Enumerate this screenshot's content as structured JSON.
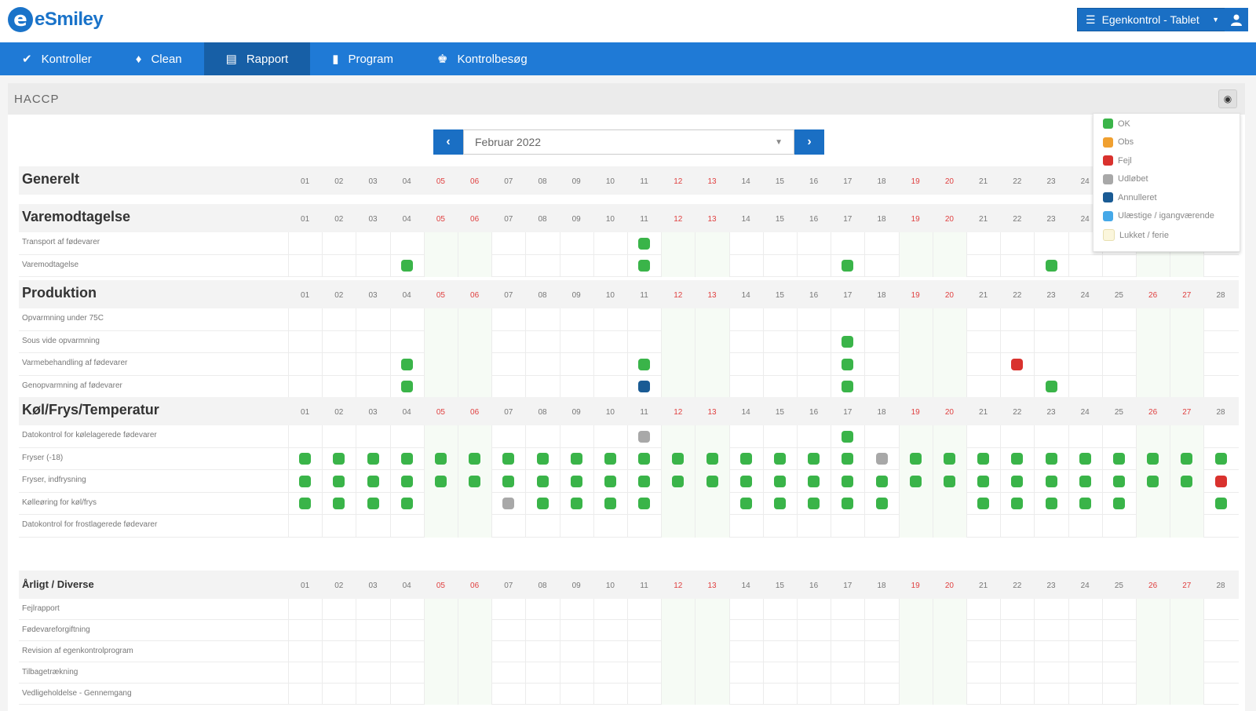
{
  "app": {
    "logo_mark": "e",
    "logo_text": "eSmiley"
  },
  "header": {
    "profile_label": "Egenkontrol - Tablet"
  },
  "nav": [
    {
      "label": "Kontroller",
      "icon": "check-icon",
      "glyph": "✔"
    },
    {
      "label": "Clean",
      "icon": "drop-icon",
      "glyph": "♦"
    },
    {
      "label": "Rapport",
      "icon": "report-icon",
      "glyph": "▤",
      "active": true
    },
    {
      "label": "Program",
      "icon": "program-icon",
      "glyph": "▮"
    },
    {
      "label": "Kontrolbesøg",
      "icon": "visit-icon",
      "glyph": "♚"
    }
  ],
  "panel": {
    "title": "HACCP"
  },
  "month": {
    "label": "Februar 2022",
    "prev_glyph": "‹",
    "next_glyph": "›"
  },
  "colors": {
    "ok": "#3ab449",
    "obs": "#f0a030",
    "fejl": "#d9322e",
    "udfoert": "#a8a8a8",
    "annulleret": "#1a5b94",
    "ulaest": "#45a8e8",
    "lukket": "#fbf6dc"
  },
  "legend": [
    {
      "label": "OK",
      "status": "ok"
    },
    {
      "label": "Obs",
      "status": "obs"
    },
    {
      "label": "Fejl",
      "status": "fejl"
    },
    {
      "label": "Udløbet",
      "status": "udfoert"
    },
    {
      "label": "Annulleret",
      "status": "annulleret"
    },
    {
      "label": "Ulæstige / igangværende",
      "status": "ulaest"
    },
    {
      "label": "Lukket / ferie",
      "status": "lukket"
    }
  ],
  "days": [
    "01",
    "02",
    "03",
    "04",
    "05",
    "06",
    "07",
    "08",
    "09",
    "10",
    "11",
    "12",
    "13",
    "14",
    "15",
    "16",
    "17",
    "18",
    "19",
    "20",
    "21",
    "22",
    "23",
    "24",
    "25",
    "26",
    "27",
    "28"
  ],
  "weekend_days": [
    5,
    6,
    12,
    13,
    19,
    20,
    26,
    27
  ],
  "sections": [
    {
      "title": "Generelt",
      "rows": []
    },
    {
      "title": "Varemodtagelse",
      "rows": [
        {
          "label": "Transport af fødevarer",
          "marks": [
            {
              "day": 11,
              "status": "ok"
            }
          ]
        },
        {
          "label": "Varemodtagelse",
          "marks": [
            {
              "day": 4,
              "status": "ok"
            },
            {
              "day": 11,
              "status": "ok"
            },
            {
              "day": 17,
              "status": "ok"
            },
            {
              "day": 23,
              "status": "ok"
            }
          ]
        }
      ]
    },
    {
      "title": "Produktion",
      "rows": [
        {
          "label": "Opvarmning under 75C",
          "marks": []
        },
        {
          "label": "Sous vide opvarmning",
          "marks": [
            {
              "day": 17,
              "status": "ok"
            }
          ]
        },
        {
          "label": "Varmebehandling af fødevarer",
          "marks": [
            {
              "day": 4,
              "status": "ok"
            },
            {
              "day": 11,
              "status": "ok"
            },
            {
              "day": 17,
              "status": "ok"
            },
            {
              "day": 22,
              "status": "fejl"
            }
          ]
        },
        {
          "label": "Genopvarmning af fødevarer",
          "marks": [
            {
              "day": 4,
              "status": "ok"
            },
            {
              "day": 11,
              "status": "annulleret"
            },
            {
              "day": 17,
              "status": "ok"
            },
            {
              "day": 23,
              "status": "ok"
            }
          ]
        }
      ]
    },
    {
      "title": "Køl/Frys/Temperatur",
      "rows": [
        {
          "label": "Datokontrol for kølelagerede fødevarer",
          "marks": [
            {
              "day": 11,
              "status": "udfoert"
            },
            {
              "day": 17,
              "status": "ok"
            }
          ]
        },
        {
          "label": "Fryser (-18)",
          "marks": [
            {
              "day": 1,
              "status": "ok"
            },
            {
              "day": 2,
              "status": "ok"
            },
            {
              "day": 3,
              "status": "ok"
            },
            {
              "day": 4,
              "status": "ok"
            },
            {
              "day": 5,
              "status": "ok"
            },
            {
              "day": 6,
              "status": "ok"
            },
            {
              "day": 7,
              "status": "ok"
            },
            {
              "day": 8,
              "status": "ok"
            },
            {
              "day": 9,
              "status": "ok"
            },
            {
              "day": 10,
              "status": "ok"
            },
            {
              "day": 11,
              "status": "ok"
            },
            {
              "day": 12,
              "status": "ok"
            },
            {
              "day": 13,
              "status": "ok"
            },
            {
              "day": 14,
              "status": "ok"
            },
            {
              "day": 15,
              "status": "ok"
            },
            {
              "day": 16,
              "status": "ok"
            },
            {
              "day": 17,
              "status": "ok"
            },
            {
              "day": 18,
              "status": "udfoert"
            },
            {
              "day": 19,
              "status": "ok"
            },
            {
              "day": 20,
              "status": "ok"
            },
            {
              "day": 21,
              "status": "ok"
            },
            {
              "day": 22,
              "status": "ok"
            },
            {
              "day": 23,
              "status": "ok"
            },
            {
              "day": 24,
              "status": "ok"
            },
            {
              "day": 25,
              "status": "ok"
            },
            {
              "day": 26,
              "status": "ok"
            },
            {
              "day": 27,
              "status": "ok"
            },
            {
              "day": 28,
              "status": "ok"
            }
          ]
        },
        {
          "label": "Fryser, indfrysning",
          "marks": [
            {
              "day": 1,
              "status": "ok"
            },
            {
              "day": 2,
              "status": "ok"
            },
            {
              "day": 3,
              "status": "ok"
            },
            {
              "day": 4,
              "status": "ok"
            },
            {
              "day": 5,
              "status": "ok"
            },
            {
              "day": 6,
              "status": "ok"
            },
            {
              "day": 7,
              "status": "ok"
            },
            {
              "day": 8,
              "status": "ok"
            },
            {
              "day": 9,
              "status": "ok"
            },
            {
              "day": 10,
              "status": "ok"
            },
            {
              "day": 11,
              "status": "ok"
            },
            {
              "day": 12,
              "status": "ok"
            },
            {
              "day": 13,
              "status": "ok"
            },
            {
              "day": 14,
              "status": "ok"
            },
            {
              "day": 15,
              "status": "ok"
            },
            {
              "day": 16,
              "status": "ok"
            },
            {
              "day": 17,
              "status": "ok"
            },
            {
              "day": 18,
              "status": "ok"
            },
            {
              "day": 19,
              "status": "ok"
            },
            {
              "day": 20,
              "status": "ok"
            },
            {
              "day": 21,
              "status": "ok"
            },
            {
              "day": 22,
              "status": "ok"
            },
            {
              "day": 23,
              "status": "ok"
            },
            {
              "day": 24,
              "status": "ok"
            },
            {
              "day": 25,
              "status": "ok"
            },
            {
              "day": 26,
              "status": "ok"
            },
            {
              "day": 27,
              "status": "ok"
            },
            {
              "day": 28,
              "status": "fejl"
            }
          ]
        },
        {
          "label": "Kølleøring for køl/frys",
          "marks": [
            {
              "day": 1,
              "status": "ok"
            },
            {
              "day": 2,
              "status": "ok"
            },
            {
              "day": 3,
              "status": "ok"
            },
            {
              "day": 4,
              "status": "ok"
            },
            {
              "day": 7,
              "status": "udfoert"
            },
            {
              "day": 8,
              "status": "ok"
            },
            {
              "day": 9,
              "status": "ok"
            },
            {
              "day": 10,
              "status": "ok"
            },
            {
              "day": 11,
              "status": "ok"
            },
            {
              "day": 14,
              "status": "ok"
            },
            {
              "day": 15,
              "status": "ok"
            },
            {
              "day": 16,
              "status": "ok"
            },
            {
              "day": 17,
              "status": "ok"
            },
            {
              "day": 18,
              "status": "ok"
            },
            {
              "day": 21,
              "status": "ok"
            },
            {
              "day": 22,
              "status": "ok"
            },
            {
              "day": 23,
              "status": "ok"
            },
            {
              "day": 24,
              "status": "ok"
            },
            {
              "day": 25,
              "status": "ok"
            },
            {
              "day": 28,
              "status": "ok"
            }
          ]
        },
        {
          "label": "Datokontrol for frostlagerede fødevarer",
          "marks": []
        }
      ]
    },
    {
      "title": "Årligt / Diverse",
      "small": true,
      "rows": [
        {
          "label": "Fejlrapport",
          "marks": []
        },
        {
          "label": "Fødevareforgiftning",
          "marks": []
        },
        {
          "label": "Revision af egenkontrolprogram",
          "marks": []
        },
        {
          "label": "Tilbagetrækning",
          "marks": []
        },
        {
          "label": "Vedligeholdelse - Gennemgang",
          "marks": []
        }
      ]
    }
  ]
}
